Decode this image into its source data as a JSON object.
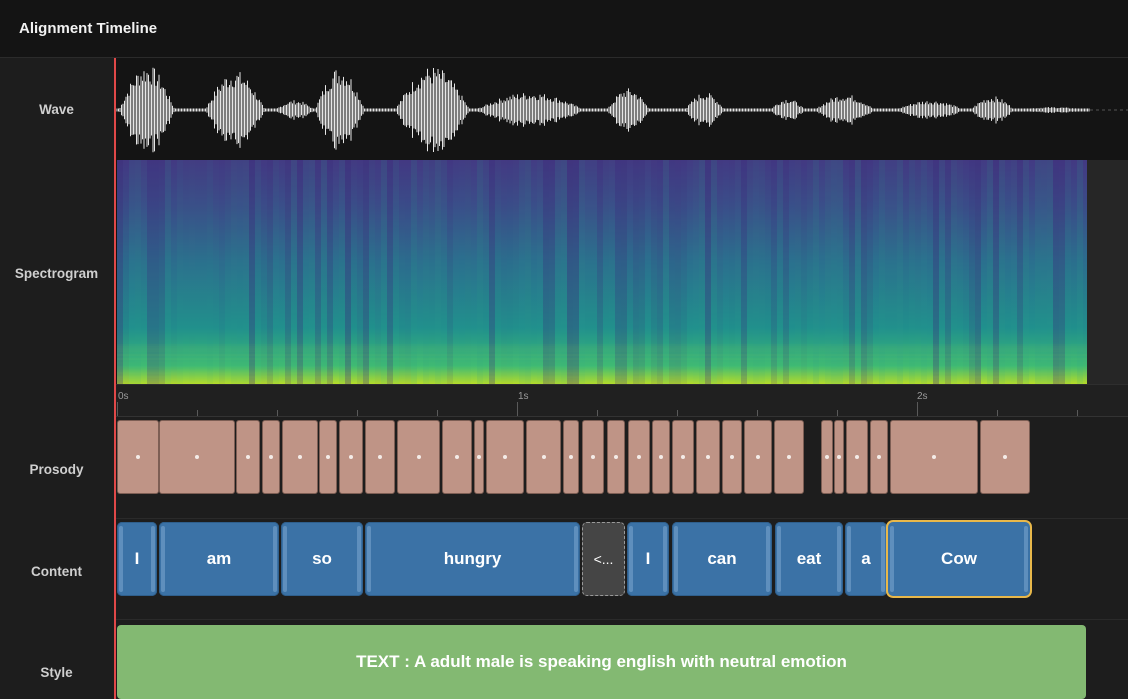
{
  "title": "Alignment Timeline",
  "labels": {
    "wave": "Wave",
    "spectrogram": "Spectrogram",
    "prosody": "Prosody",
    "content": "Content",
    "style": "Style"
  },
  "ruler": {
    "ticks": [
      "0s",
      "1s",
      "2s"
    ]
  },
  "content_words": [
    "I",
    "am",
    "so",
    "hungry",
    "<...",
    "I",
    "can",
    "eat",
    "a",
    "Cow"
  ],
  "selected_word": "Cow",
  "style_text": "TEXT : A adult male is speaking english with neutral emotion",
  "colors": {
    "playhead": "#e04848",
    "prosody": "#bf9486",
    "word": "#3b72a6",
    "selected_outline": "#e8b84a",
    "style": "#83b972"
  }
}
